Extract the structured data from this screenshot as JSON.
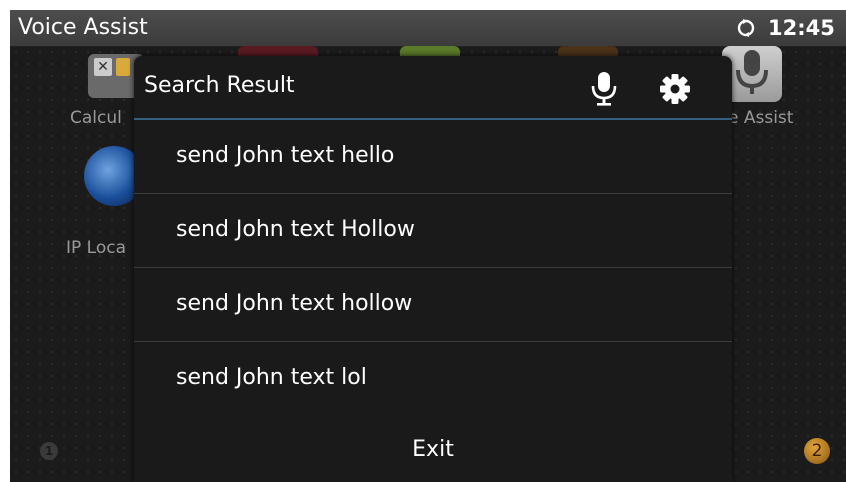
{
  "status_bar": {
    "title": "Voice Assist",
    "time": "12:45",
    "sync_icon": "sync-icon"
  },
  "launcher": {
    "apps": [
      {
        "label": "Calcul",
        "icon": "calculator-icon"
      },
      {
        "label": "IP Loca",
        "icon": "globe-icon"
      },
      {
        "label": "e Assist",
        "icon": "microphone-icon"
      }
    ],
    "pages": [
      "1",
      "2"
    ]
  },
  "dialog": {
    "title": "Search Result",
    "mic_icon": "microphone-icon",
    "settings_icon": "gear-icon",
    "results": [
      "send John text hello",
      "send John text Hollow",
      "send John text hollow",
      "send John text lol"
    ],
    "exit_label": "Exit"
  },
  "colors": {
    "status_bar": "#3b3b3b",
    "dialog_bg": "#1a1a1a",
    "header_accent": "#35607f",
    "page_badge": "#d89a2e"
  }
}
